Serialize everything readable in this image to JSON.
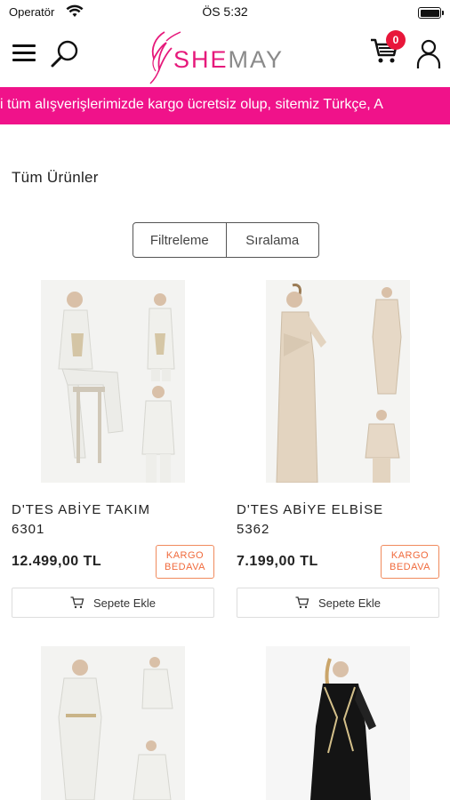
{
  "status_bar": {
    "carrier": "Operatör",
    "time": "ÖS 5:32"
  },
  "header": {
    "logo_she": "SHE",
    "logo_may": "MAY",
    "cart_count": "0",
    "icons": [
      "menu-icon",
      "search-icon",
      "cart-icon",
      "user-icon"
    ]
  },
  "marquee": {
    "text": "i tüm alışverişlerimizde kargo ücretsiz olup, sitemiz Türkçe, A"
  },
  "section_title": "Tüm Ürünler",
  "filters": {
    "filter_label": "Filtreleme",
    "sort_label": "Sıralama"
  },
  "products": [
    {
      "name_line1": "D'TES ABİYE TAKIM",
      "name_line2": "6301",
      "price": "12.499,00 TL",
      "badge_line1": "KARGO",
      "badge_line2": "BEDAVA",
      "add_label": "Sepete Ekle"
    },
    {
      "name_line1": "D'TES ABİYE ELBİSE",
      "name_line2": "5362",
      "price": "7.199,00 TL",
      "badge_line1": "KARGO",
      "badge_line2": "BEDAVA",
      "add_label": "Sepete Ekle"
    },
    {},
    {}
  ],
  "colors": {
    "brand_pink": "#f0128a",
    "badge_orange": "#f06a3c",
    "cart_badge_red": "#e8163a"
  }
}
